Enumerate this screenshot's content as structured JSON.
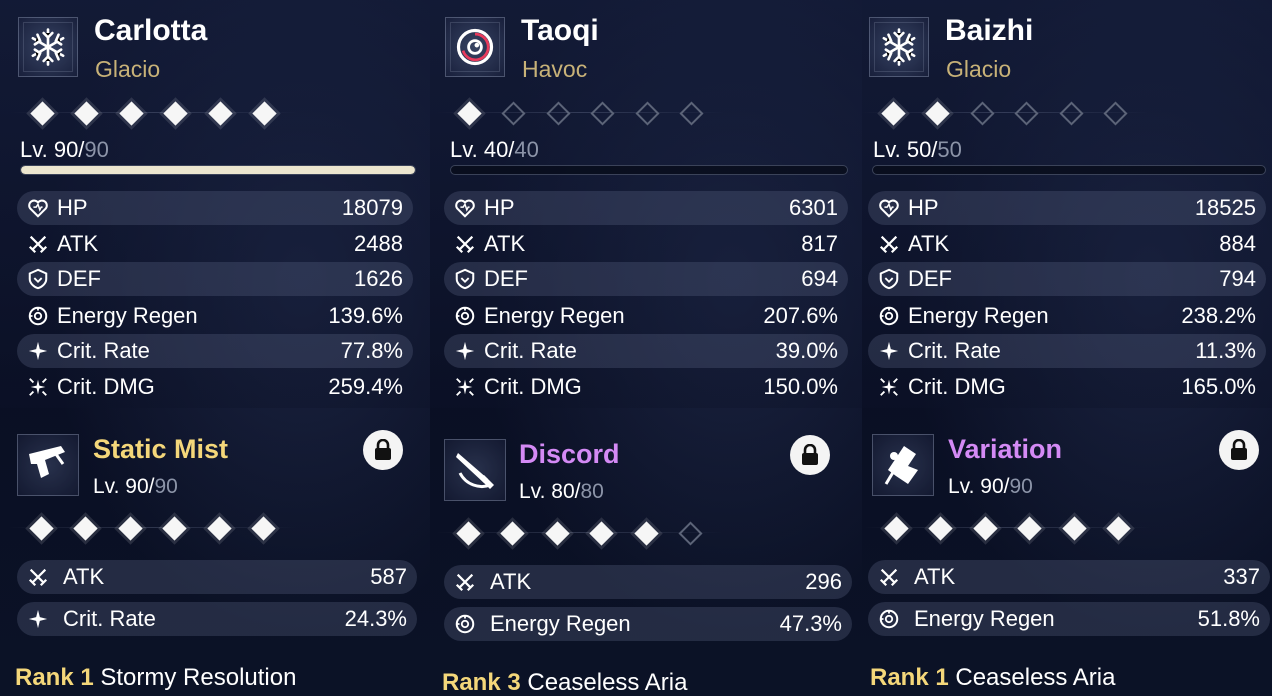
{
  "colors": {
    "glacio": "#c8b278",
    "havoc": "#c8b278",
    "weapon_gold": "#f4d77a",
    "weapon_purple": "#d48af5",
    "rank": "#f4d77a"
  },
  "characters": [
    {
      "name": "Carlotta",
      "element": "Glacio",
      "emblem_icon": "snowflake-icon",
      "sequence": [
        true,
        true,
        true,
        true,
        true,
        true
      ],
      "level": "Lv. 90/",
      "level_max": "90",
      "level_progress": 1.0,
      "stats": [
        {
          "icon": "heart-icon",
          "label": "HP",
          "value": "18079"
        },
        {
          "icon": "crossed-swords-icon",
          "label": "ATK",
          "value": "2488"
        },
        {
          "icon": "shield-icon",
          "label": "DEF",
          "value": "1626"
        },
        {
          "icon": "energy-regen-icon",
          "label": "Energy Regen",
          "value": "139.6%"
        },
        {
          "icon": "crit-rate-icon",
          "label": "Crit. Rate",
          "value": "77.8%"
        },
        {
          "icon": "crit-dmg-icon",
          "label": "Crit. DMG",
          "value": "259.4%"
        }
      ],
      "weapon": {
        "name": "Static Mist",
        "name_color": "#f4d77a",
        "icon": "pistol-icon",
        "level": "Lv. 90/",
        "level_max": "90",
        "rank_stars": [
          true,
          true,
          true,
          true,
          true,
          true
        ],
        "stats": [
          {
            "icon": "crossed-swords-icon",
            "label": "ATK",
            "value": "587"
          },
          {
            "icon": "crit-rate-icon",
            "label": "Crit. Rate",
            "value": "24.3%"
          }
        ],
        "rank_label": "Rank 1",
        "passive": "Stormy Resolution"
      }
    },
    {
      "name": "Taoqi",
      "element": "Havoc",
      "emblem_icon": "havoc-swirl-icon",
      "sequence": [
        true,
        false,
        false,
        false,
        false,
        false
      ],
      "level": "Lv. 40/",
      "level_max": "40",
      "level_progress": 0.0,
      "stats": [
        {
          "icon": "heart-icon",
          "label": "HP",
          "value": "6301"
        },
        {
          "icon": "crossed-swords-icon",
          "label": "ATK",
          "value": "817"
        },
        {
          "icon": "shield-icon",
          "label": "DEF",
          "value": "694"
        },
        {
          "icon": "energy-regen-icon",
          "label": "Energy Regen",
          "value": "207.6%"
        },
        {
          "icon": "crit-rate-icon",
          "label": "Crit. Rate",
          "value": "39.0%"
        },
        {
          "icon": "crit-dmg-icon",
          "label": "Crit. DMG",
          "value": "150.0%"
        }
      ],
      "weapon": {
        "name": "Discord",
        "name_color": "#d48af5",
        "icon": "broadblade-icon",
        "level": "Lv. 80/",
        "level_max": "80",
        "rank_stars": [
          true,
          true,
          true,
          true,
          true,
          false
        ],
        "stats": [
          {
            "icon": "crossed-swords-icon",
            "label": "ATK",
            "value": "296"
          },
          {
            "icon": "energy-regen-icon",
            "label": "Energy Regen",
            "value": "47.3%"
          }
        ],
        "rank_label": "Rank 3",
        "passive": "Ceaseless Aria"
      }
    },
    {
      "name": "Baizhi",
      "element": "Glacio",
      "emblem_icon": "snowflake-icon",
      "sequence": [
        true,
        true,
        false,
        false,
        false,
        false
      ],
      "level": "Lv. 50/",
      "level_max": "50",
      "level_progress": 0.0,
      "stats": [
        {
          "icon": "heart-icon",
          "label": "HP",
          "value": "18525"
        },
        {
          "icon": "crossed-swords-icon",
          "label": "ATK",
          "value": "884"
        },
        {
          "icon": "shield-icon",
          "label": "DEF",
          "value": "794"
        },
        {
          "icon": "energy-regen-icon",
          "label": "Energy Regen",
          "value": "238.2%"
        },
        {
          "icon": "crit-rate-icon",
          "label": "Crit. Rate",
          "value": "11.3%"
        },
        {
          "icon": "crit-dmg-icon",
          "label": "Crit. DMG",
          "value": "165.0%"
        }
      ],
      "weapon": {
        "name": "Variation",
        "name_color": "#d48af5",
        "icon": "rectifier-icon",
        "level": "Lv. 90/",
        "level_max": "90",
        "rank_stars": [
          true,
          true,
          true,
          true,
          true,
          true
        ],
        "stats": [
          {
            "icon": "crossed-swords-icon",
            "label": "ATK",
            "value": "337"
          },
          {
            "icon": "energy-regen-icon",
            "label": "Energy Regen",
            "value": "51.8%"
          }
        ],
        "rank_label": "Rank 1",
        "passive": "Ceaseless Aria"
      }
    }
  ]
}
